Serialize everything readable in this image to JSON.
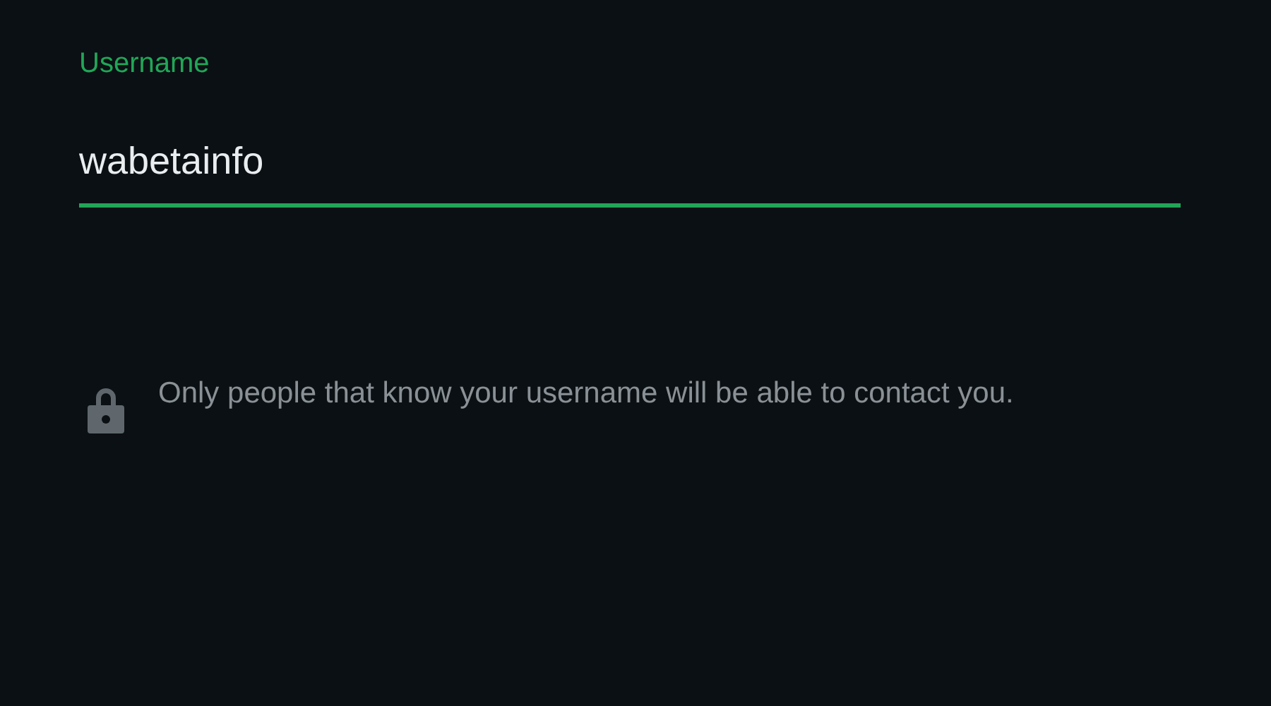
{
  "username_field": {
    "label": "Username",
    "value": "wabetainfo",
    "focused": true
  },
  "privacy_note": {
    "text": "Only people that know your username will be able to contact you."
  }
}
